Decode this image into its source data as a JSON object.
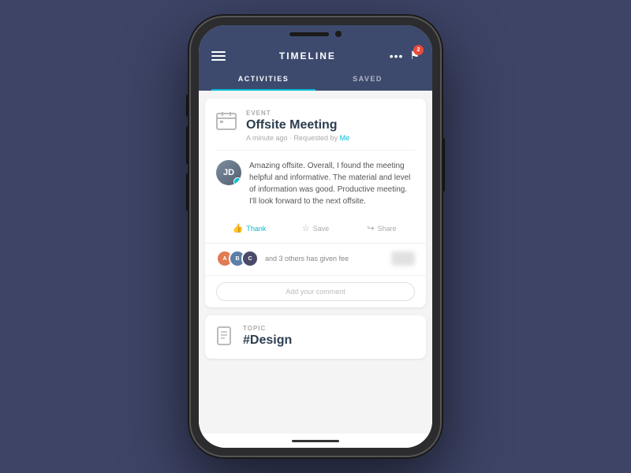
{
  "header": {
    "title": "TIMELINE",
    "menu_label": "menu",
    "dots_label": "more options",
    "notification_count": "2",
    "flag_label": "notifications"
  },
  "tabs": [
    {
      "label": "ACTIVITIES",
      "active": true
    },
    {
      "label": "SAVED",
      "active": false
    }
  ],
  "card1": {
    "event_type": "EVENT",
    "event_title": "Offsite Meeting",
    "event_meta": "A minute ago · Requested by ",
    "event_meta_link": "Me",
    "comment_text": "Amazing offsite. Overall, I found the meeting helpful and informative. The material and level of information was good. Productive meeting. I'll look forward to the next offsite.",
    "actions": {
      "thank_label": "Thank",
      "save_label": "Save",
      "share_label": "Share"
    },
    "feedback_text": "and 3 others has given fee",
    "comment_placeholder": "Add your comment"
  },
  "card2": {
    "topic_type": "TOPIC",
    "topic_title": "#Design"
  },
  "avatars": [
    {
      "initials": "A",
      "color": "#e07b54"
    },
    {
      "initials": "B",
      "color": "#5b7fa6"
    },
    {
      "initials": "C",
      "color": "#4a4a6a"
    }
  ]
}
